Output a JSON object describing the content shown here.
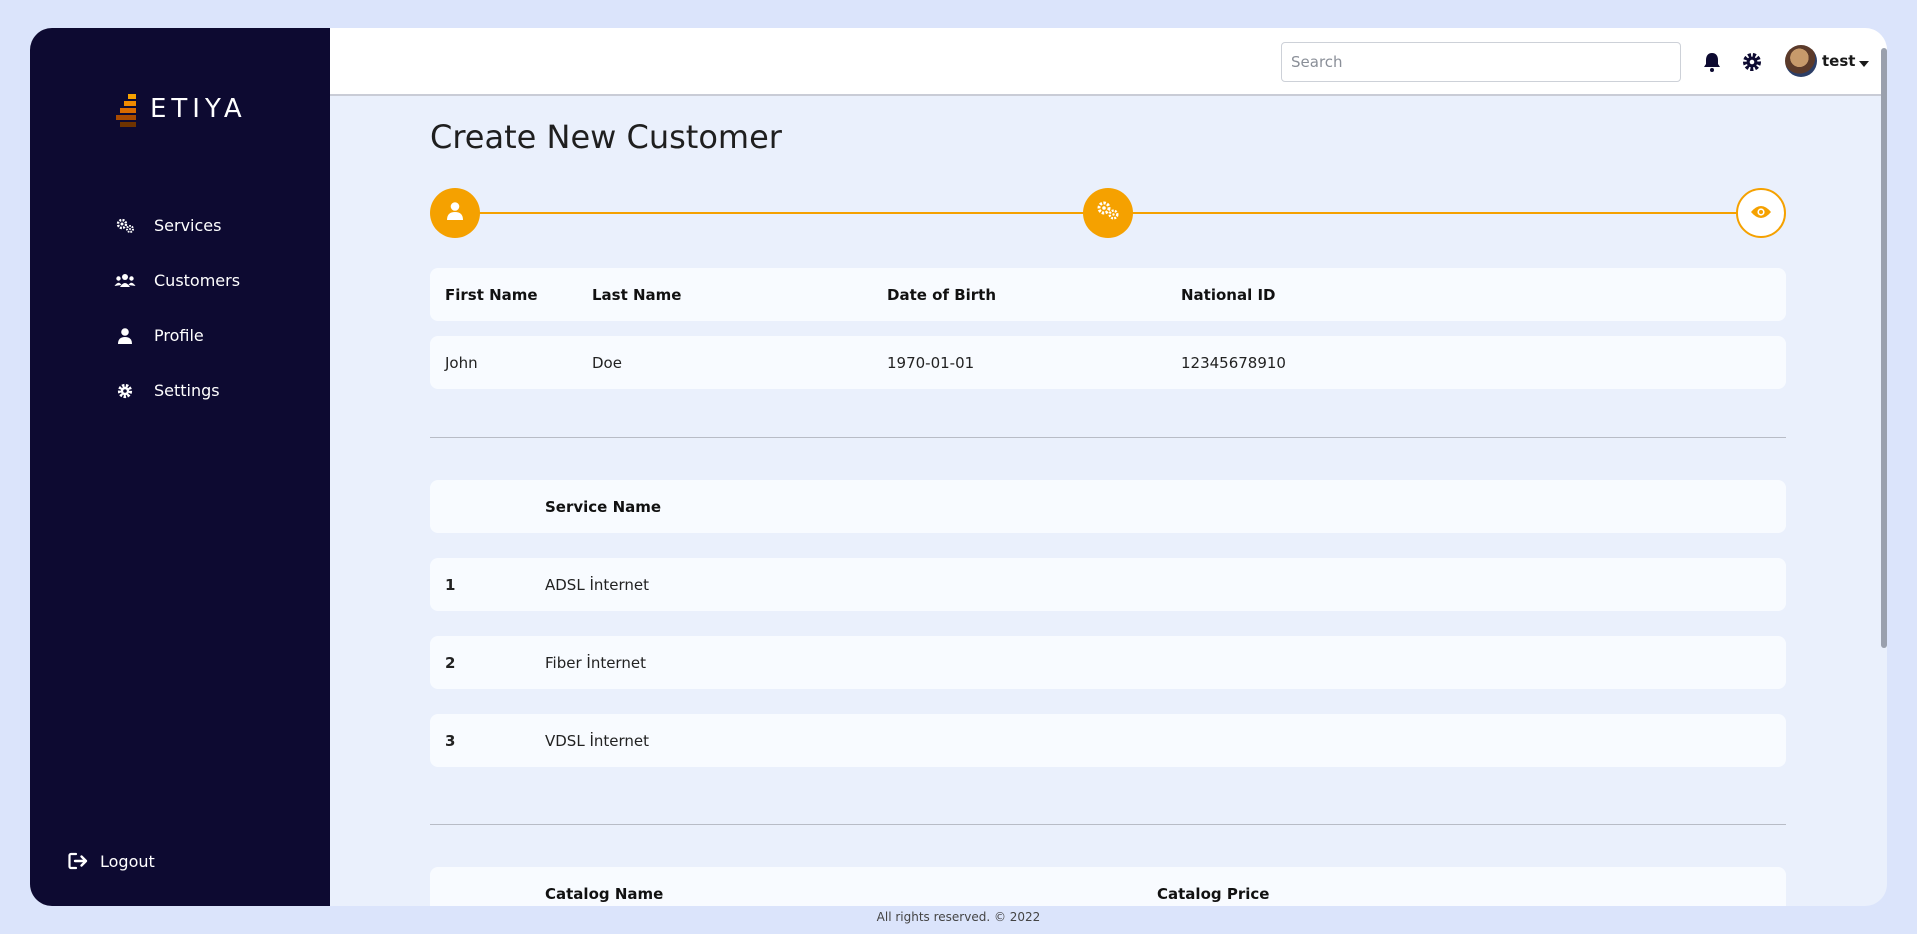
{
  "brand": {
    "name": "ETIYA",
    "accent": "#f5a100",
    "sidebar_bg": "#0d0a31"
  },
  "sidebar": {
    "items": [
      {
        "label": "Services",
        "icon": "gears-icon"
      },
      {
        "label": "Customers",
        "icon": "users-icon"
      },
      {
        "label": "Profile",
        "icon": "user-icon"
      },
      {
        "label": "Settings",
        "icon": "gear-icon"
      }
    ],
    "logout_label": "Logout"
  },
  "topbar": {
    "search_placeholder": "Search",
    "user_name": "test"
  },
  "page": {
    "title": "Create New Customer"
  },
  "stepper": {
    "steps": [
      "user-icon",
      "gears-icon",
      "eye-icon"
    ],
    "current_step": 3
  },
  "customer_table": {
    "headers": {
      "first_name": "First Name",
      "last_name": "Last Name",
      "dob": "Date of Birth",
      "national_id": "National ID"
    },
    "row": {
      "first_name": "John",
      "last_name": "Doe",
      "dob": "1970-01-01",
      "national_id": "12345678910"
    }
  },
  "services_table": {
    "header": "Service Name",
    "rows": [
      {
        "num": "1",
        "name": "ADSL İnternet"
      },
      {
        "num": "2",
        "name": "Fiber İnternet"
      },
      {
        "num": "3",
        "name": "VDSL İnternet"
      }
    ]
  },
  "catalog_table": {
    "headers": {
      "name": "Catalog Name",
      "price": "Catalog Price"
    }
  },
  "footer": {
    "text": "All rights reserved. © 2022"
  }
}
